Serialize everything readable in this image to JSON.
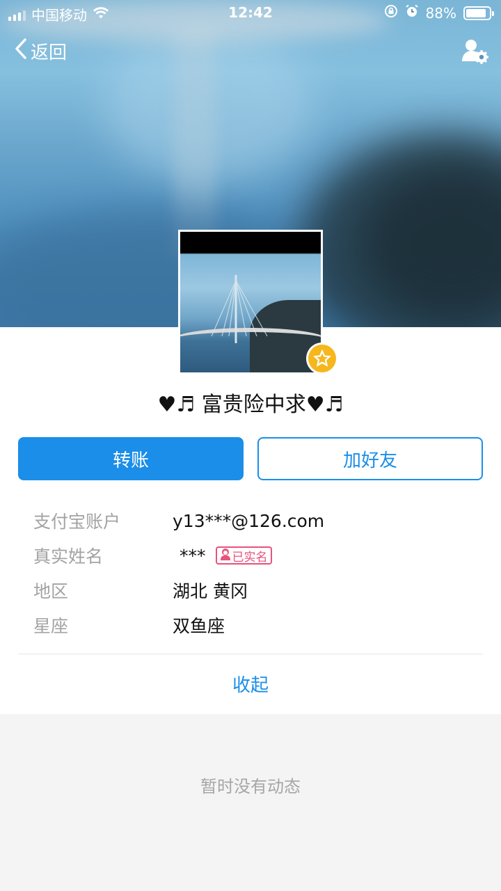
{
  "status_bar": {
    "carrier": "中国移动",
    "time": "12:42",
    "battery_percent": "88%",
    "battery_level": 0.88
  },
  "nav": {
    "back_label": "返回",
    "settings_icon": "user-settings-icon"
  },
  "profile": {
    "name": "♥♬ 富贵险中求♥♬",
    "badge_icon": "star-icon"
  },
  "actions": {
    "transfer_label": "转账",
    "add_friend_label": "加好友"
  },
  "info_rows": [
    {
      "key": "支付宝账户",
      "value": "y13***@126.com"
    },
    {
      "key": "真实姓名",
      "value": "***",
      "tag": "已实名"
    },
    {
      "key": "地区",
      "value": "湖北 黄冈"
    },
    {
      "key": "星座",
      "value": "双鱼座"
    }
  ],
  "collapse_label": "收起",
  "empty_feed_text": "暂时没有动态",
  "colors": {
    "accent": "#1a8ee8",
    "verified_tag": "#e8527b",
    "badge": "#f6b71d"
  }
}
